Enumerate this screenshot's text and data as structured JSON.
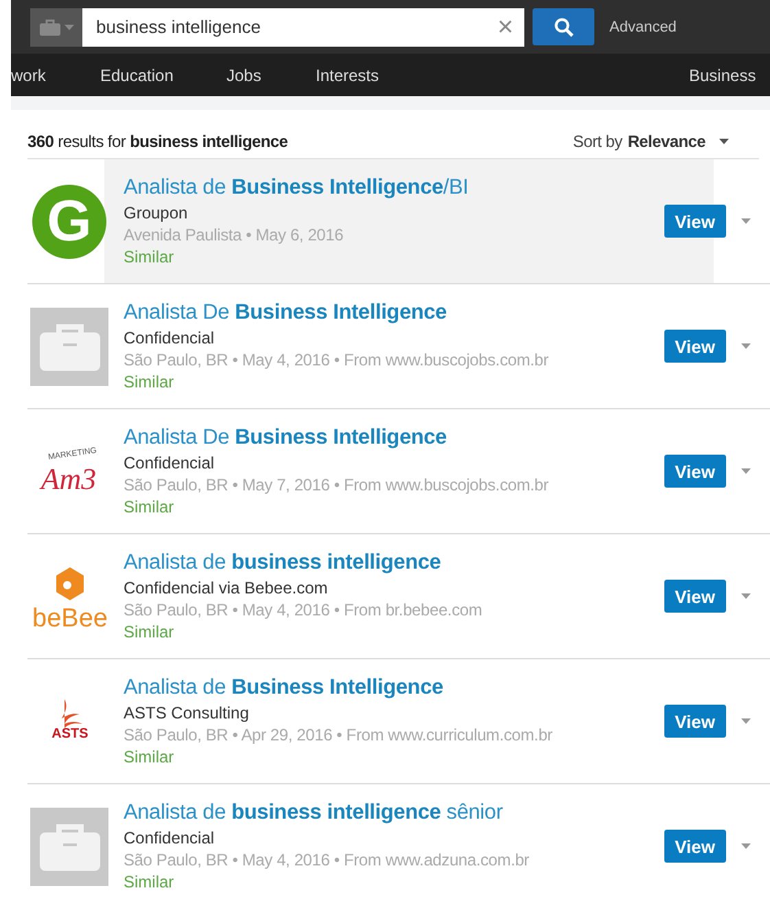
{
  "search": {
    "value": "business intelligence",
    "clear": "×",
    "advanced": "Advanced"
  },
  "nav": [
    {
      "label": "work"
    },
    {
      "label": "Education"
    },
    {
      "label": "Jobs"
    },
    {
      "label": "Interests"
    },
    {
      "label": "Business"
    }
  ],
  "results_header": {
    "summary": "**360** results for **business intelligence**",
    "sort_label": "Sort by",
    "sort_value": "Relevance"
  },
  "results": [
    {
      "title": "Analista de **Business Intelligence**/BI",
      "company": "Groupon",
      "meta": "Avenida Paulista  • May 6, 2016",
      "similar": "Similar",
      "button": "View",
      "highlighted": true,
      "logo": {
        "kind": "circle",
        "text": "G"
      }
    },
    {
      "title": "Analista De **Business Intelligence**",
      "company": "Confidencial",
      "meta": "São Paulo, BR • May 4, 2016 • From www.buscojobs.com.br",
      "similar": "Similar",
      "button": "View",
      "highlighted": false,
      "logo": {
        "kind": "placeholder"
      }
    },
    {
      "title": "Analista De **Business Intelligence**",
      "company": "Confidencial",
      "meta": "São Paulo, BR • May 7, 2016 • From www.buscojobs.com.br",
      "similar": "Similar",
      "button": "View",
      "highlighted": false,
      "logo": {
        "kind": "script",
        "text": "Am3",
        "subtext": "MARKETING"
      }
    },
    {
      "title": "Analista de **business intelligence**",
      "company": "Confidencial via Bebee.com",
      "meta": "São Paulo, BR • May 4, 2016 • From br.bebee.com",
      "similar": "Similar",
      "button": "View",
      "highlighted": false,
      "logo": {
        "kind": "bee",
        "text": "beBee"
      }
    },
    {
      "title": "Analista de **Business Intelligence**",
      "company": "ASTS Consulting",
      "meta": "São Paulo, BR • Apr 29, 2016 • From www.curriculum.com.br",
      "similar": "Similar",
      "button": "View",
      "highlighted": false,
      "logo": {
        "kind": "flame",
        "text": "ASTS"
      }
    },
    {
      "title": "Analista de **business intelligence** sênior",
      "company": "Confidencial",
      "meta": "São Paulo, BR • May 4, 2016 • From www.adzuna.com.br",
      "similar": "Similar",
      "button": "View",
      "highlighted": false,
      "logo": {
        "kind": "placeholder"
      }
    }
  ]
}
